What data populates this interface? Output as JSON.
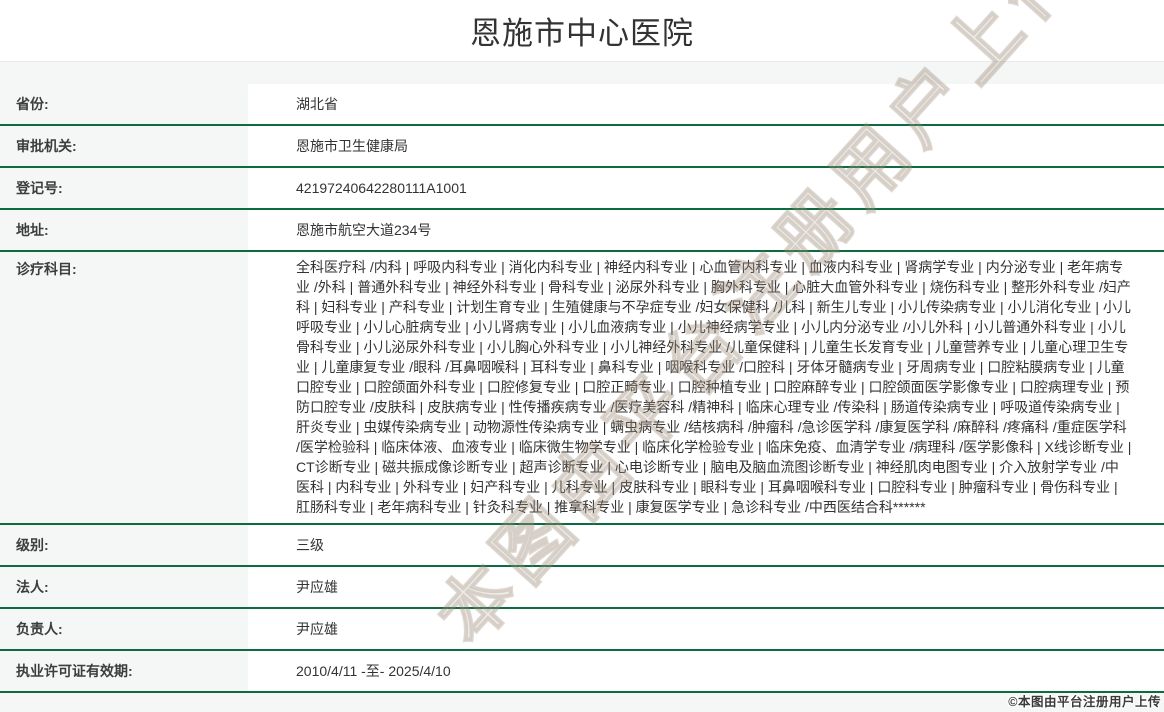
{
  "page": {
    "title": "恩施市中心医院"
  },
  "colors": {
    "accent_green": "#0c6b40",
    "label_text": "#3d3d3d",
    "value_text": "#333333",
    "page_bg": "#f5f6f6",
    "header_divider": "#e9e9e9"
  },
  "fields": [
    {
      "label": "省份:",
      "value": "湖北省"
    },
    {
      "label": "审批机关:",
      "value": "恩施市卫生健康局"
    },
    {
      "label": "登记号:",
      "value": "42197240642280111A1001"
    },
    {
      "label": "地址:",
      "value": "恩施市航空大道234号"
    },
    {
      "label": "诊疗科目:",
      "value": "全科医疗科 /内科 | 呼吸内科专业 | 消化内科专业 | 神经内科专业 | 心血管内科专业 | 血液内科专业 | 肾病学专业 | 内分泌专业 | 老年病专业 /外科 | 普通外科专业 | 神经外科专业 | 骨科专业 | 泌尿外科专业 | 胸外科专业 | 心脏大血管外科专业 | 烧伤科专业 | 整形外科专业 /妇产科 | 妇科专业 | 产科专业 | 计划生育专业 | 生殖健康与不孕症专业 /妇女保健科 /儿科 | 新生儿专业 | 小儿传染病专业 | 小儿消化专业 | 小儿呼吸专业 | 小儿心脏病专业 | 小儿肾病专业 | 小儿血液病专业 | 小儿神经病学专业 | 小儿内分泌专业 /小儿外科 | 小儿普通外科专业 | 小儿骨科专业 | 小儿泌尿外科专业 | 小儿胸心外科专业 | 小儿神经外科专业 /儿童保健科 | 儿童生长发育专业 | 儿童营养专业 | 儿童心理卫生专业 | 儿童康复专业 /眼科 /耳鼻咽喉科 | 耳科专业 | 鼻科专业 | 咽喉科专业 /口腔科 | 牙体牙髓病专业 | 牙周病专业 | 口腔粘膜病专业 | 儿童口腔专业 | 口腔颌面外科专业 | 口腔修复专业 | 口腔正畸专业 | 口腔种植专业 | 口腔麻醉专业 | 口腔颌面医学影像专业 | 口腔病理专业 | 预防口腔专业 /皮肤科 | 皮肤病专业 | 性传播疾病专业 /医疗美容科 /精神科 | 临床心理专业 /传染科 | 肠道传染病专业 | 呼吸道传染病专业 | 肝炎专业 | 虫媒传染病专业 | 动物源性传染病专业 | 螨虫病专业 /结核病科 /肿瘤科 /急诊医学科 /康复医学科 /麻醉科 /疼痛科 /重症医学科 /医学检验科 | 临床体液、血液专业 | 临床微生物学专业 | 临床化学检验专业 | 临床免疫、血清学专业 /病理科 /医学影像科 | X线诊断专业 | CT诊断专业 | 磁共振成像诊断专业 | 超声诊断专业 | 心电诊断专业 | 脑电及脑血流图诊断专业 | 神经肌肉电图专业 | 介入放射学专业 /中医科 | 内科专业 | 外科专业 | 妇产科专业 | 儿科专业 | 皮肤科专业 | 眼科专业 | 耳鼻咽喉科专业 | 口腔科专业 | 肿瘤科专业 | 骨伤科专业 | 肛肠科专业 | 老年病科专业 | 针灸科专业 | 推拿科专业 | 康复医学专业 | 急诊科专业 /中西医结合科******"
    },
    {
      "label": "级别:",
      "value": "三级"
    },
    {
      "label": "法人:",
      "value": "尹应雄"
    },
    {
      "label": "负责人:",
      "value": "尹应雄"
    },
    {
      "label": "执业许可证有效期:",
      "value": "2010/4/11 -至- 2025/4/10"
    }
  ],
  "watermarks": {
    "corner": "©本图由平台注册用户上传",
    "diagonal": "本图由平台注册用户上传"
  }
}
